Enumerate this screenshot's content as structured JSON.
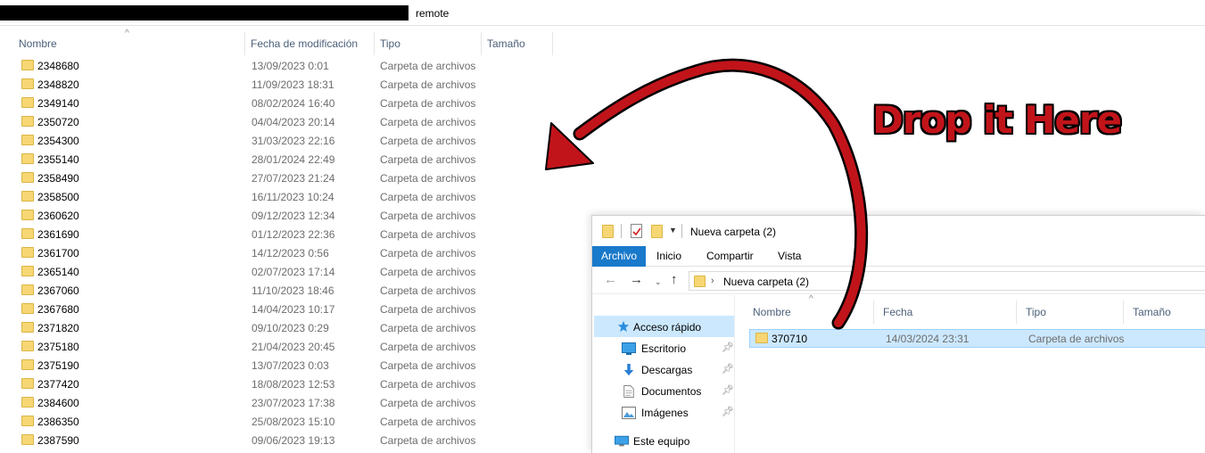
{
  "background_window": {
    "address_suffix": "remote",
    "columns": {
      "name": "Nombre",
      "date": "Fecha de modificación",
      "type": "Tipo",
      "size": "Tamaño"
    },
    "rows": [
      {
        "name": "2348680",
        "date": "13/09/2023 0:01",
        "type": "Carpeta de archivos"
      },
      {
        "name": "2348820",
        "date": "11/09/2023 18:31",
        "type": "Carpeta de archivos"
      },
      {
        "name": "2349140",
        "date": "08/02/2024 16:40",
        "type": "Carpeta de archivos"
      },
      {
        "name": "2350720",
        "date": "04/04/2023 20:14",
        "type": "Carpeta de archivos"
      },
      {
        "name": "2354300",
        "date": "31/03/2023 22:16",
        "type": "Carpeta de archivos"
      },
      {
        "name": "2355140",
        "date": "28/01/2024 22:49",
        "type": "Carpeta de archivos"
      },
      {
        "name": "2358490",
        "date": "27/07/2023 21:24",
        "type": "Carpeta de archivos"
      },
      {
        "name": "2358500",
        "date": "16/11/2023 10:24",
        "type": "Carpeta de archivos"
      },
      {
        "name": "2360620",
        "date": "09/12/2023 12:34",
        "type": "Carpeta de archivos"
      },
      {
        "name": "2361690",
        "date": "01/12/2023 22:36",
        "type": "Carpeta de archivos"
      },
      {
        "name": "2361700",
        "date": "14/12/2023 0:56",
        "type": "Carpeta de archivos"
      },
      {
        "name": "2365140",
        "date": "02/07/2023 17:14",
        "type": "Carpeta de archivos"
      },
      {
        "name": "2367060",
        "date": "11/10/2023 18:46",
        "type": "Carpeta de archivos"
      },
      {
        "name": "2367680",
        "date": "14/04/2023 10:17",
        "type": "Carpeta de archivos"
      },
      {
        "name": "2371820",
        "date": "09/10/2023 0:29",
        "type": "Carpeta de archivos"
      },
      {
        "name": "2375180",
        "date": "21/04/2023 20:45",
        "type": "Carpeta de archivos"
      },
      {
        "name": "2375190",
        "date": "13/07/2023 0:03",
        "type": "Carpeta de archivos"
      },
      {
        "name": "2377420",
        "date": "18/08/2023 12:53",
        "type": "Carpeta de archivos"
      },
      {
        "name": "2384600",
        "date": "23/07/2023 17:38",
        "type": "Carpeta de archivos"
      },
      {
        "name": "2386350",
        "date": "25/08/2023 15:10",
        "type": "Carpeta de archivos"
      },
      {
        "name": "2387590",
        "date": "09/06/2023 19:13",
        "type": "Carpeta de archivos"
      }
    ]
  },
  "foreground_window": {
    "title": "Nueva carpeta (2)",
    "ribbon_tabs": [
      "Archivo",
      "Inicio",
      "Compartir",
      "Vista"
    ],
    "path": "Nueva carpeta (2)",
    "nav_pane": {
      "quick_access": "Acceso rápido",
      "items": [
        "Escritorio",
        "Descargas",
        "Documentos",
        "Imágenes"
      ],
      "this_pc": "Este equipo"
    },
    "columns": {
      "name": "Nombre",
      "date": "Fecha",
      "type": "Tipo",
      "size": "Tamaño"
    },
    "rows": [
      {
        "name": "370710",
        "date": "14/03/2024 23:31",
        "type": "Carpeta de archivos"
      }
    ]
  },
  "annotation": {
    "text": "Drop it Here",
    "color": "#c1141a"
  },
  "colors": {
    "folder": "#f7d774",
    "selection": "#cce8ff",
    "ribbon_active": "#1979ca",
    "header_text": "#4c607a"
  }
}
